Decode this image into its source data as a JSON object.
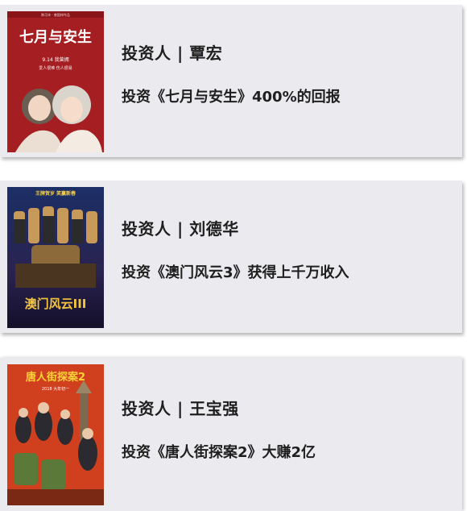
{
  "cards": [
    {
      "investor_label": "投资人 | 覃宏",
      "detail": "投资《七月与安生》400%的回报",
      "poster": {
        "title": "七月与安生",
        "date": "9.14 我曾拥",
        "tagline": "爱人很难  伤人很易",
        "credits": "陈可辛 · 曾国祥作品",
        "bg_color": "#a01c1f"
      }
    },
    {
      "investor_label": "投资人 | 刘德华",
      "detail": "投资《澳门风云3》获得上千万收入",
      "poster": {
        "title": "澳门风云III",
        "tagline": "王牌贺岁  笑赢新春",
        "bg_color": "#1a2a5a"
      }
    },
    {
      "investor_label": "投资人 | 王宝强",
      "detail": "投资《唐人街探案2》大赚2亿",
      "poster": {
        "title": "唐人街探案2",
        "date": "2018 大年初一",
        "bg_color": "#c8381e"
      }
    }
  ]
}
